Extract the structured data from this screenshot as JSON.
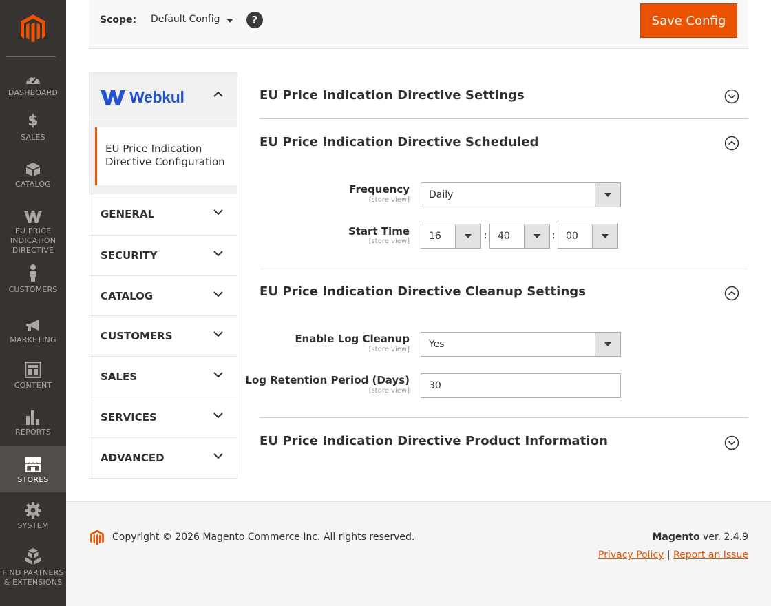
{
  "nav": {
    "items": [
      {
        "label": "DASHBOARD",
        "icon": "dashboard-icon"
      },
      {
        "label": "SALES",
        "icon": "dollar-icon"
      },
      {
        "label": "CATALOG",
        "icon": "cube-icon"
      },
      {
        "label": "EU PRICE INDICATION DIRECTIVE",
        "icon": "webkul-icon"
      },
      {
        "label": "CUSTOMERS",
        "icon": "person-icon"
      },
      {
        "label": "MARKETING",
        "icon": "megaphone-icon"
      },
      {
        "label": "CONTENT",
        "icon": "layout-icon"
      },
      {
        "label": "REPORTS",
        "icon": "bar-chart-icon"
      },
      {
        "label": "STORES",
        "icon": "store-icon"
      },
      {
        "label": "SYSTEM",
        "icon": "gear-icon"
      },
      {
        "label": "FIND PARTNERS & EXTENSIONS",
        "icon": "boxes-icon"
      }
    ],
    "active": "STORES"
  },
  "header": {
    "scope_label": "Scope:",
    "scope_value": "Default Config",
    "help": "?",
    "save_label": "Save Config"
  },
  "tabs": {
    "brand": "Webkul",
    "active_item": "EU Price Indication Directive Configuration",
    "sections": [
      "GENERAL",
      "SECURITY",
      "CATALOG",
      "CUSTOMERS",
      "SALES",
      "SERVICES",
      "ADVANCED"
    ]
  },
  "main": {
    "sections": [
      {
        "title": "EU Price Indication Directive Settings",
        "expanded": false
      },
      {
        "title": "EU Price Indication Directive Scheduled",
        "expanded": true
      },
      {
        "title": "EU Price Indication Directive Cleanup Settings",
        "expanded": true
      },
      {
        "title": "EU Price Indication Directive Product Information",
        "expanded": false
      }
    ],
    "scheduled": {
      "frequency_label": "Frequency",
      "frequency_scope": "[store view]",
      "frequency_value": "Daily",
      "start_time_label": "Start Time",
      "start_time_scope": "[store view]",
      "hour": "16",
      "minute": "40",
      "second": "00",
      "separator": ":"
    },
    "cleanup": {
      "enable_label": "Enable Log Cleanup",
      "enable_scope": "[store view]",
      "enable_value": "Yes",
      "retention_label": "Log Retention Period (Days)",
      "retention_scope": "[store view]",
      "retention_value": "30"
    }
  },
  "footer": {
    "copyright": "Copyright © 2026 Magento Commerce Inc. All rights reserved.",
    "brand": "Magento",
    "version": " ver. 2.4.9",
    "privacy": "Privacy Policy",
    "separator": " | ",
    "report": "Report an Issue"
  },
  "colors": {
    "accent": "#eb5202",
    "nav_bg": "#373330",
    "nav_active": "#524d49",
    "webkul_blue": "#2153cc"
  }
}
